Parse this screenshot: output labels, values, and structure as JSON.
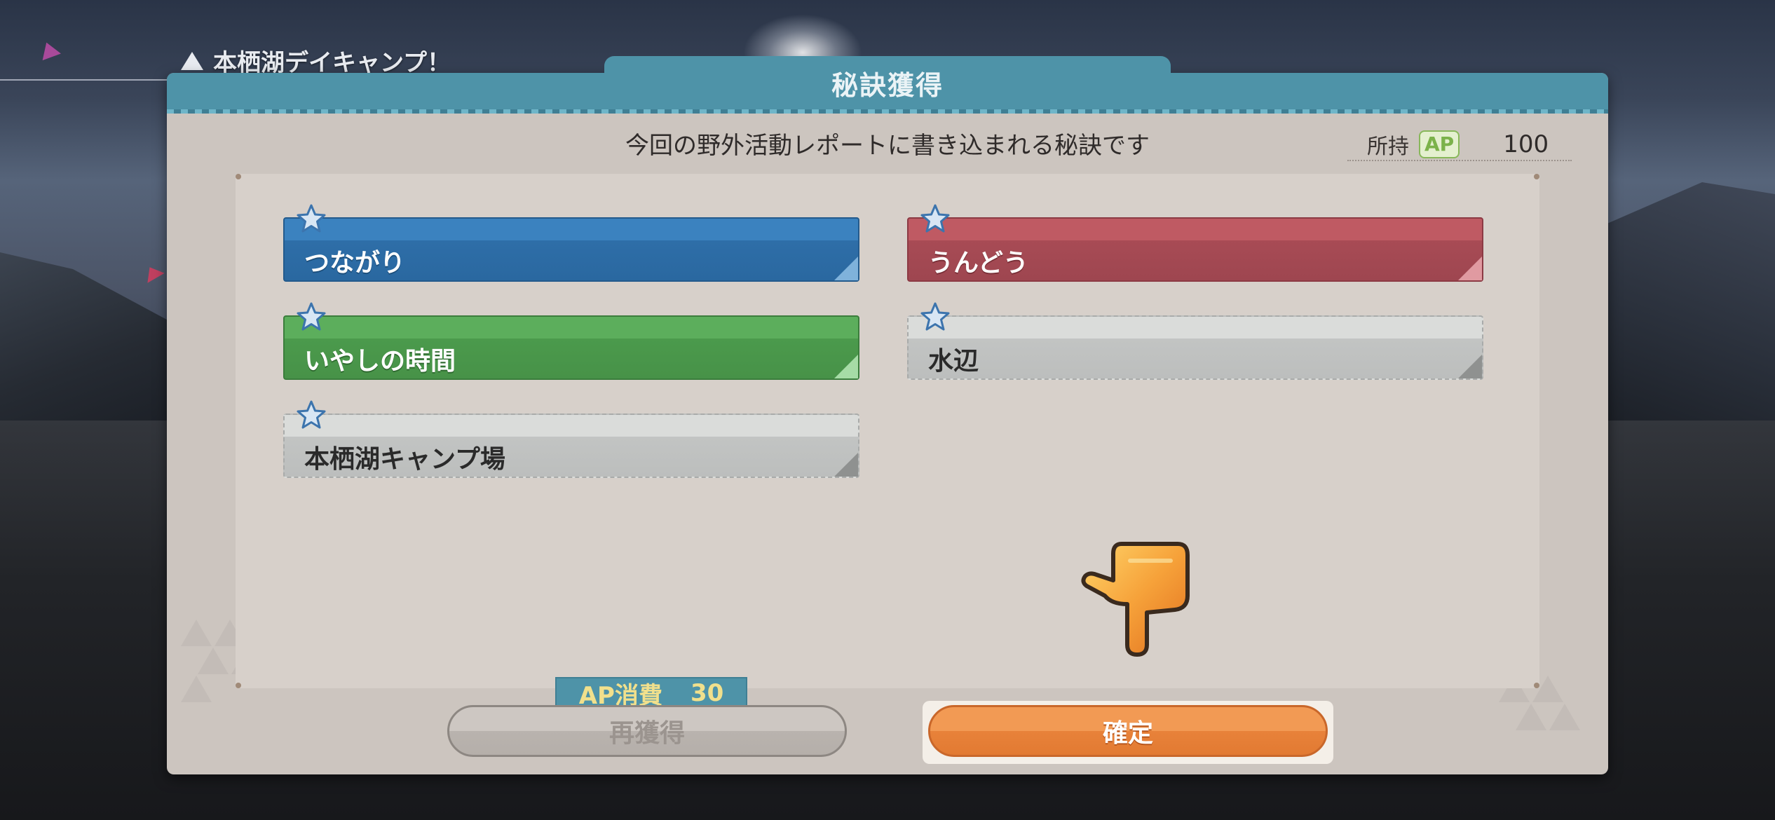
{
  "stage": {
    "title": "本栖湖デイキャンプ！"
  },
  "dialog": {
    "tab_title": "秘訣獲得",
    "subtitle": "今回の野外活動レポートに書き込まれる秘訣です",
    "ap_owned_label": "所持",
    "ap_badge": "AP",
    "ap_owned_value": "100"
  },
  "skills": [
    {
      "label": "つながり",
      "color": "#2e6ea8",
      "icon": "star-icon"
    },
    {
      "label": "うんどう",
      "color": "#a84b55",
      "icon": "star-icon"
    },
    {
      "label": "いやしの時間",
      "color": "#4b9a4c",
      "icon": "star-icon"
    },
    {
      "label": "水辺",
      "color": "#c2c4c3",
      "icon": "star-icon"
    },
    {
      "label": "本栖湖キャンプ場",
      "color": "#c2c4c3",
      "icon": "star-icon"
    }
  ],
  "ap_cost": {
    "label": "AP消費",
    "value": "30"
  },
  "buttons": {
    "reacquire": "再獲得",
    "confirm": "確定"
  },
  "colors": {
    "accent_teal": "#4e93a8",
    "confirm_orange": "#e8823a"
  },
  "hint_icon": "pointing-hand-icon"
}
